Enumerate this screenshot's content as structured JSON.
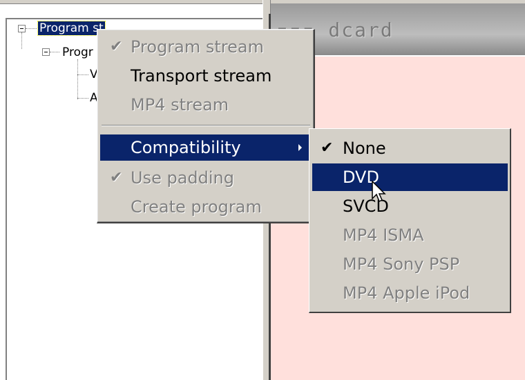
{
  "tree": {
    "root_label": "Program st",
    "child_label": "Progr",
    "leaf1_label": "V",
    "leaf2_label": "A"
  },
  "header": {
    "brand": "▪▪▪ dcard"
  },
  "menu": {
    "items": [
      {
        "label": "Program stream",
        "checked": true,
        "enabled": false
      },
      {
        "label": "Transport stream",
        "checked": false,
        "enabled": true
      },
      {
        "label": "MP4 stream",
        "checked": false,
        "enabled": false
      },
      {
        "label": "Compatibility",
        "submenu": true,
        "highlighted": true
      },
      {
        "label": "Use padding",
        "checked": true,
        "enabled": false
      },
      {
        "label": "Create program",
        "checked": false,
        "enabled": false
      }
    ],
    "check_glyph": "✔"
  },
  "submenu": {
    "items": [
      {
        "label": "None",
        "checked": true,
        "enabled": true
      },
      {
        "label": "DVD",
        "enabled": true,
        "highlighted": true
      },
      {
        "label": "SVCD",
        "enabled": true
      },
      {
        "label": "MP4 ISMA",
        "enabled": false
      },
      {
        "label": "MP4 Sony PSP",
        "enabled": false
      },
      {
        "label": "MP4 Apple iPod",
        "enabled": false
      }
    ]
  },
  "colors": {
    "highlight": "#0a246a",
    "menu_bg": "#d4d0c8",
    "pane_bg": "#ffe0dc"
  },
  "icons": {
    "cursor": "arrow-pointer-icon"
  }
}
